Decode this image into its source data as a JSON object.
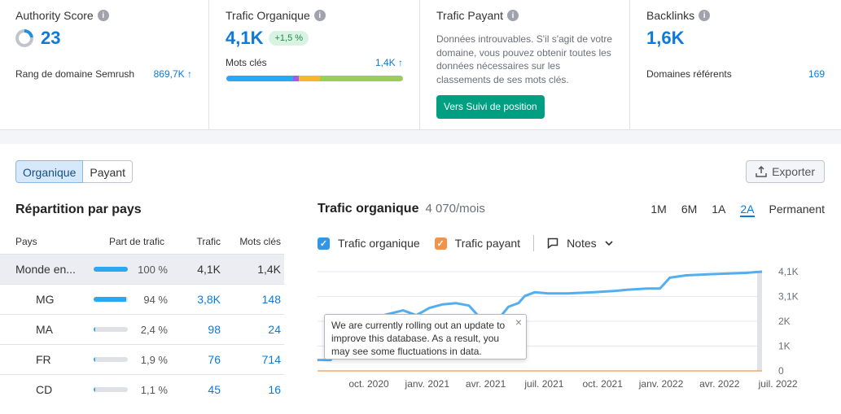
{
  "authority": {
    "title": "Authority Score",
    "value": "23",
    "rank_label": "Rang de domaine Semrush",
    "rank_value": "869,7K ↑"
  },
  "organic": {
    "title": "Trafic Organique",
    "value": "4,1K",
    "badge": "+1,5 %",
    "kw_label": "Mots clés",
    "kw_value": "1,4K ↑",
    "kw_bar": [
      {
        "color": "#2aa7f5",
        "share": 0.38
      },
      {
        "color": "#a855f7",
        "share": 0.03
      },
      {
        "color": "#f8b62d",
        "share": 0.12
      },
      {
        "color": "#9ccd57",
        "share": 0.47
      }
    ]
  },
  "paid": {
    "title": "Trafic Payant",
    "text": "Données introuvables. S'il s'agit de votre domaine, vous pouvez obtenir toutes les données nécessaires sur les classements de ses mots clés.",
    "button": "Vers Suivi de position"
  },
  "backlinks": {
    "title": "Backlinks",
    "value": "1,6K",
    "ref_label": "Domaines référents",
    "ref_value": "169"
  },
  "tabs": {
    "organic": "Organique",
    "paid": "Payant"
  },
  "export_label": "Exporter",
  "countries": {
    "title": "Répartition par pays",
    "headers": {
      "country": "Pays",
      "share": "Part de trafic",
      "traffic": "Trafic",
      "keywords": "Mots clés"
    },
    "rows": [
      {
        "country": "Monde en...",
        "share_val": 1.0,
        "share": "100 %",
        "traffic": "4,1K",
        "keywords": "1,4K"
      },
      {
        "country": "MG",
        "share_val": 0.94,
        "share": "94 %",
        "traffic": "3,8K",
        "keywords": "148"
      },
      {
        "country": "MA",
        "share_val": 0.024,
        "share": "2,4 %",
        "traffic": "98",
        "keywords": "24"
      },
      {
        "country": "FR",
        "share_val": 0.019,
        "share": "1,9 %",
        "traffic": "76",
        "keywords": "714"
      },
      {
        "country": "CD",
        "share_val": 0.011,
        "share": "1,1 %",
        "traffic": "45",
        "keywords": "16"
      }
    ]
  },
  "chart_head": {
    "title": "Trafic organique",
    "value": "4 070/mois"
  },
  "periods": [
    "1M",
    "6M",
    "1A",
    "2A",
    "Permanent"
  ],
  "active_period": "2A",
  "legend": {
    "organic": "Trafic organique",
    "paid": "Trafic payant",
    "notes": "Notes"
  },
  "tooltip": "We are currently rolling out an update to improve this database. As a result, you may see some fluctuations in data.",
  "colors": {
    "accent": "#0c7ad9",
    "organic_line": "#53aef0",
    "paid_line": "#f7a968",
    "green": "#009f81"
  },
  "chart_data": {
    "type": "line",
    "x_ticks": [
      "oct. 2020",
      "janv. 2021",
      "avr. 2021",
      "juil. 2021",
      "oct. 2021",
      "janv. 2022",
      "avr. 2022",
      "juil. 2022"
    ],
    "y_ticks": [
      "4,1K",
      "3,1K",
      "2K",
      "1K",
      "0"
    ],
    "ylim": [
      0,
      4100
    ],
    "series": [
      {
        "name": "Trafic organique",
        "color": "#53aef0",
        "points": [
          [
            0,
            450
          ],
          [
            0.04,
            450
          ],
          [
            0.08,
            1350
          ],
          [
            0.16,
            1600
          ],
          [
            0.2,
            2300
          ],
          [
            0.26,
            2500
          ],
          [
            0.3,
            2300
          ],
          [
            0.34,
            2600
          ],
          [
            0.38,
            2750
          ],
          [
            0.42,
            2800
          ],
          [
            0.46,
            2700
          ],
          [
            0.5,
            2100
          ],
          [
            0.52,
            1950
          ],
          [
            0.55,
            2150
          ],
          [
            0.58,
            2650
          ],
          [
            0.61,
            2800
          ],
          [
            0.63,
            3100
          ],
          [
            0.66,
            3250
          ],
          [
            0.7,
            3200
          ],
          [
            0.76,
            3200
          ],
          [
            0.84,
            3250
          ],
          [
            0.9,
            3300
          ],
          [
            0.94,
            3350
          ],
          [
            1.0,
            3400
          ],
          [
            1.04,
            3400
          ],
          [
            1.07,
            3850
          ],
          [
            1.12,
            3950
          ],
          [
            1.2,
            4000
          ],
          [
            1.3,
            4050
          ],
          [
            1.35,
            4100
          ]
        ]
      },
      {
        "name": "Trafic payant",
        "color": "#f7a968",
        "points": [
          [
            0,
            0
          ],
          [
            1.35,
            0
          ]
        ]
      }
    ]
  }
}
